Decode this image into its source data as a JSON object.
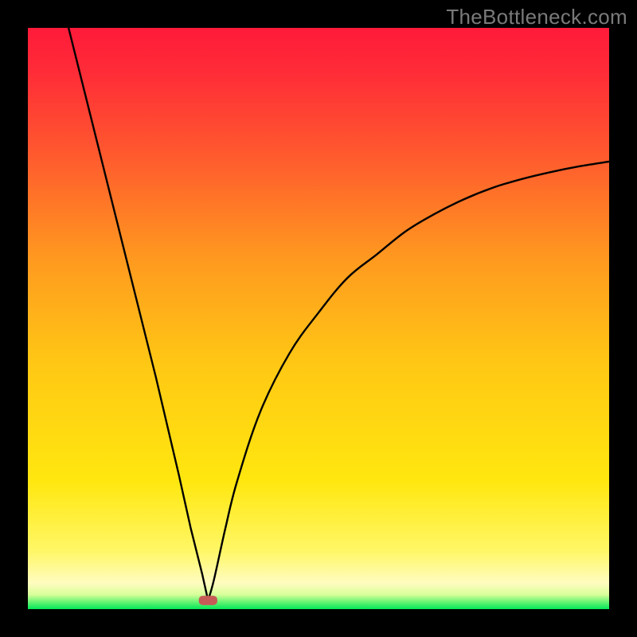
{
  "attribution": "TheBottleneck.com",
  "chart_data": {
    "type": "line",
    "title": "",
    "xlabel": "",
    "ylabel": "",
    "xlim": [
      0,
      100
    ],
    "ylim": [
      0,
      100
    ],
    "grid": false,
    "background_gradient": {
      "top_color": "#ff1a3a",
      "mid_color": "#ffd400",
      "bottom_band_color": "#00e858",
      "bottom_band_fraction": 0.02
    },
    "curve": {
      "description": "V-shaped bottleneck curve: sharp minimum near x≈31, left branch near-linear steep, right branch concave rising.",
      "min_x": 31,
      "min_y": 1.5,
      "left_top": {
        "x": 7,
        "y": 100
      },
      "right_end": {
        "x": 100,
        "y": 77
      }
    },
    "marker": {
      "shape": "rounded-rect",
      "x": 31,
      "y": 1.5,
      "color": "#c65a56",
      "width": 3.2,
      "height": 1.6
    },
    "series": [
      {
        "name": "bottleneck-curve",
        "x": [
          7,
          10,
          14,
          18,
          22,
          26,
          28,
          30,
          31,
          32,
          34,
          36,
          40,
          45,
          50,
          55,
          60,
          65,
          70,
          75,
          80,
          85,
          90,
          95,
          100
        ],
        "y": [
          100,
          88,
          72,
          56,
          40,
          23,
          14,
          6,
          1.5,
          5,
          14,
          22,
          34,
          44,
          51,
          57,
          61,
          65,
          68,
          70.5,
          72.5,
          74,
          75.2,
          76.2,
          77
        ]
      }
    ]
  }
}
